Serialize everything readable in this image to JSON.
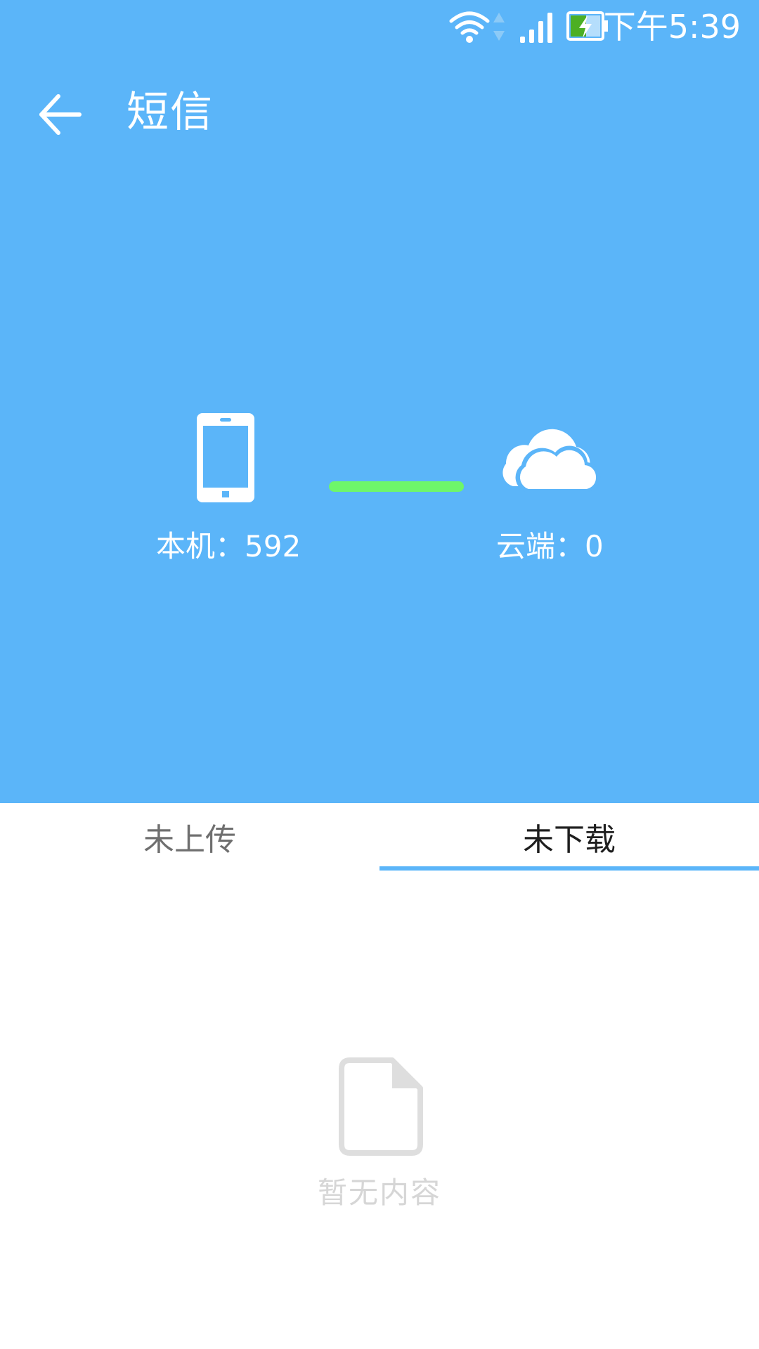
{
  "status_bar": {
    "time": "下午5:39",
    "icons": [
      "wifi-icon",
      "data-arrows-icon",
      "signal-icon",
      "battery-charging-icon"
    ],
    "battery_fill_color": "#4caf24"
  },
  "toolbar": {
    "back_icon": "arrow-left-icon",
    "title": "短信"
  },
  "sync": {
    "local_label": "本机：592",
    "cloud_label": "云端：0",
    "phone_icon": "phone-icon",
    "cloud_icon": "cloud-icon",
    "connector_color": "#6ef66a"
  },
  "tabs": [
    {
      "label": "未上传",
      "selected": false
    },
    {
      "label": "未下载",
      "selected": true
    }
  ],
  "empty_state": {
    "icon": "document-icon",
    "text": "暂无内容"
  },
  "colors": {
    "primary": "#5bb5f9",
    "tab_selected_text": "#1e1e1e",
    "tab_unselected_text": "#6f6f6f",
    "empty_gray": "#d6d6d6"
  }
}
